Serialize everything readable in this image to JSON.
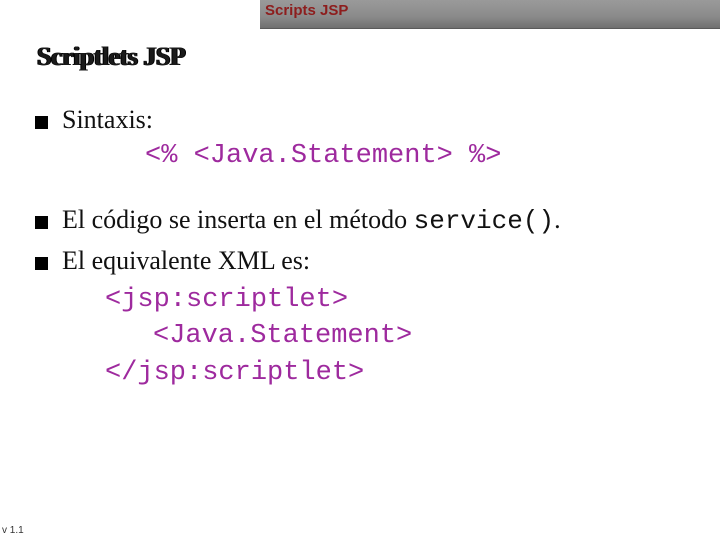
{
  "header": {
    "label": "Scripts JSP"
  },
  "title": "Scriptlets JSP",
  "bullets": {
    "b1": "Sintaxis:",
    "b2_pre": "El código se inserta en el método ",
    "b2_code": "service()",
    "b2_post": ".",
    "b3": "El equivalente XML es:"
  },
  "syntax_line": "<% <Java.Statement> %>",
  "xml": {
    "l1": "<jsp:scriptlet>",
    "l2": "<Java.Statement>",
    "l3": "</jsp:scriptlet>"
  },
  "version": "v 1.1"
}
